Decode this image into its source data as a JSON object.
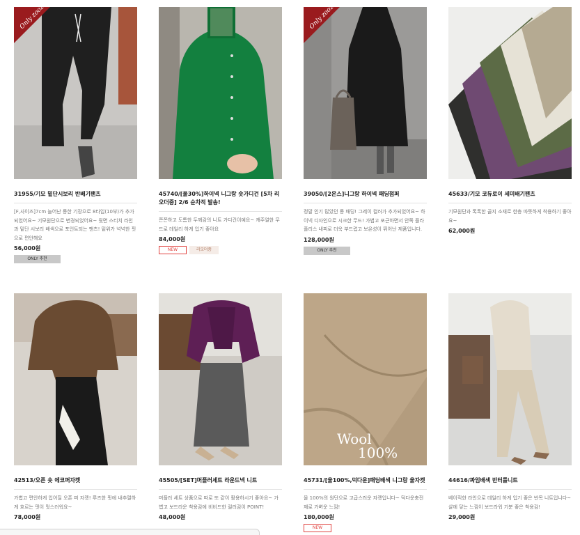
{
  "products": [
    {
      "name": "31955/기모 밑단시보리 반배기팬츠",
      "desc": "[F,사이즈]7cm 늘어난 롱한 기장으로 8타입(10부)가 추가되었어요~ 기모원단으로 변경되었어요~ 뒷면 스티치 라인과 밑단 시보리 배색으로 포인트되는 팬츠! 밑위가 넉넉한 핏으로 편안해요",
      "price": "56,000원",
      "badge": "ONLY 추천",
      "flag": "Only zoozoom"
    },
    {
      "name": "45740/[울30%]하이넥 니그랑 숏가디건 [5차 리오더중] 2/6 순차적 발송!",
      "desc": "쫀쫀하고 도톰한 두께감의 니트 가디건이예요~ 캐주얼한 무드로 데일리 하게 입기 좋아요",
      "price": "84,000원",
      "badge_new": "NEW",
      "badge_sub": "리오더중"
    },
    {
      "name": "39050/[2온스]니그랑 하이넥 패딩점퍼",
      "desc": "정말 인기 많았던 롱 패딩! 그레이 컬러가 추가되었어요~ 하이넥 디자인으로 시크한 무드! 가볍고 포근하면서 안쪽 플라플리스 내피로 더욱 부드럽고 보온성이 뛰어난 제품입니다.",
      "price": "128,000원",
      "badge": "ONLY 추천",
      "flag": "Only zoozoom"
    },
    {
      "name": "45633/기모 코듀로이 세미배기팬츠",
      "desc": "기모원단과 톡톡한 골지 소재로 한층 따뜻하게 착용하기 좋아요~",
      "price": "62,000원"
    },
    {
      "name": "42513/오픈 숏 에코퍼자켓",
      "desc": "가볍고 편안하게 입어질 오픈 퍼 자켓! 루즈한 핏에 내추럴하게 흐르는 핏이 멋스러워요~",
      "price": "78,000원"
    },
    {
      "name": "45505/[SET]머플러세트 라운드넥 니트",
      "desc": "머플러 세트 상품으로 따로 또 같이 활용하시기 좋아요~ 가볍고 보드라운 착용감에 비비드한 컬러감이 POINT!",
      "price": "48,000원"
    },
    {
      "name": "45731/[울100%,덕다운]패딩배색 니그랑 울자켓",
      "desc": "울 100%의 원단으로 고급스러운 자켓입니다~ 덕다운충전재로 가벼운 느낌!",
      "price": "180,000원",
      "badge_new": "NEW",
      "image_text": {
        "line1": "Wool",
        "line2": "100%"
      }
    },
    {
      "name": "44616/짜임배색 반터틀니트",
      "desc": "베이직한 라인으로 데일리 하게 입기 좋은 반목 니트입니다~ 살에 닿는 느낌이 보드라워 기분 좋은 착용감!",
      "price": "29,000원"
    }
  ],
  "colors": {
    "new_badge": "#e0413d",
    "only_badge_bg": "#c8c8c8",
    "flag": "#9a1b1e",
    "sub_badge_bg": "#f5ece7"
  }
}
